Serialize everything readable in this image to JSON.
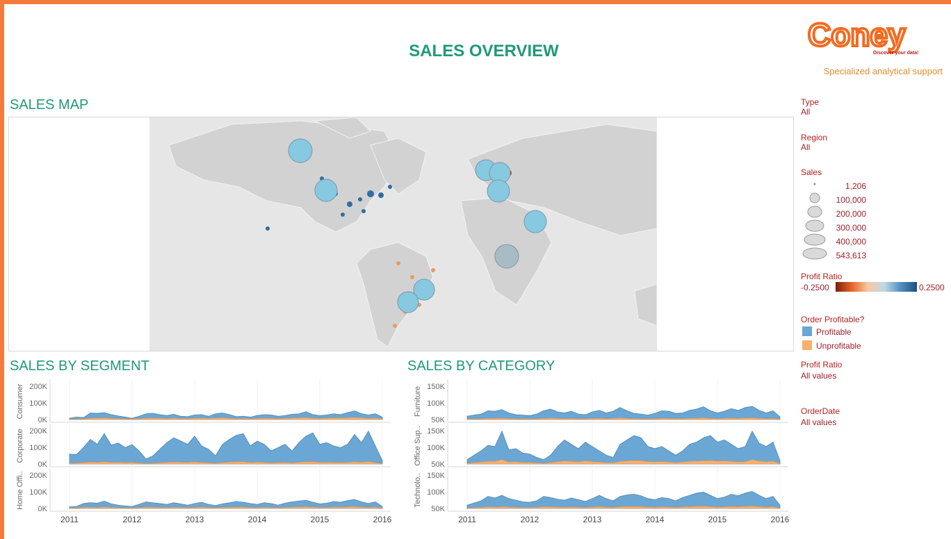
{
  "header": {
    "title": "SALES OVERVIEW",
    "logo_text": "Coney",
    "logo_tagline": "Discover your data!",
    "tagline": "Specialized analytical support"
  },
  "sections": {
    "map_title": "SALES MAP",
    "segment_title": "SALES BY SEGMENT",
    "category_title": "SALES BY CATEGORY"
  },
  "filters": {
    "type_label": "Type",
    "type_value": "All",
    "region_label": "Region",
    "region_value": "All",
    "sales_label": "Sales",
    "sales_sizes": [
      "1,206",
      "100,000",
      "200,000",
      "300,000",
      "400,000",
      "543,613"
    ],
    "profit_ratio_label": "Profit Ratio",
    "profit_ratio_min": "-0.2500",
    "profit_ratio_max": "0.2500",
    "order_profitable_label": "Order Profitable?",
    "profitable_label": "Profitable",
    "unprofitable_label": "Unprofitable",
    "profit_ratio_filter_label": "Profit Ratio",
    "profit_ratio_filter_value": "All values",
    "orderdate_label": "OrderDate",
    "orderdate_value": "All values"
  },
  "colors": {
    "profitable": "#6aa7d4",
    "unprofitable": "#f6b070",
    "accent": "#1f9a77",
    "legend_text": "#b22222"
  },
  "chart_data": [
    {
      "type": "area",
      "title": "SALES BY SEGMENT",
      "x_ticks": [
        "2011",
        "2012",
        "2013",
        "2014",
        "2015",
        "2016"
      ],
      "rows": [
        {
          "name": "Consumer",
          "y_ticks": [
            "200K",
            "100K",
            "0K"
          ],
          "ylim": [
            0,
            220000
          ],
          "profitable": [
            8000,
            15000,
            12000,
            40000,
            38000,
            42000,
            30000,
            22000,
            15000,
            8000,
            20000,
            35000,
            38000,
            30000,
            25000,
            32000,
            20000,
            18000,
            28000,
            30000,
            20000,
            35000,
            40000,
            30000,
            18000,
            20000,
            15000,
            25000,
            30000,
            28000,
            20000,
            24000,
            32000,
            35000,
            48000,
            30000,
            24000,
            28000,
            35000,
            30000,
            42000,
            52000,
            36000,
            28000,
            35000,
            15000
          ],
          "unprofitable": [
            2000,
            3000,
            4000,
            8000,
            9000,
            10000,
            7000,
            5000,
            4000,
            3000,
            5000,
            8000,
            9000,
            8000,
            6000,
            8000,
            5000,
            5000,
            8000,
            9000,
            6000,
            9000,
            11000,
            8000,
            5000,
            5000,
            4000,
            7000,
            8000,
            7000,
            5000,
            7000,
            9000,
            10000,
            12000,
            8000,
            6000,
            8000,
            10000,
            9000,
            11000,
            13000,
            10000,
            7000,
            9000,
            3000
          ]
        },
        {
          "name": "Corporate",
          "y_ticks": [
            "200K",
            "100K",
            "0K"
          ],
          "ylim": [
            0,
            220000
          ],
          "profitable": [
            60000,
            58000,
            100000,
            150000,
            120000,
            185000,
            115000,
            128000,
            100000,
            118000,
            80000,
            30000,
            50000,
            90000,
            130000,
            160000,
            140000,
            120000,
            170000,
            110000,
            90000,
            50000,
            120000,
            150000,
            175000,
            185000,
            110000,
            140000,
            120000,
            80000,
            100000,
            120000,
            80000,
            130000,
            170000,
            190000,
            120000,
            130000,
            110000,
            100000,
            120000,
            180000,
            130000,
            200000,
            110000,
            20000
          ],
          "unprofitable": [
            4000,
            5000,
            8000,
            12000,
            10000,
            14000,
            9000,
            10000,
            8000,
            9000,
            6000,
            3000,
            4000,
            7000,
            10000,
            12000,
            11000,
            9000,
            13000,
            9000,
            7000,
            4000,
            9000,
            12000,
            13000,
            14000,
            9000,
            11000,
            9000,
            6000,
            8000,
            9000,
            6000,
            10000,
            13000,
            14000,
            9000,
            10000,
            9000,
            8000,
            9000,
            13000,
            10000,
            15000,
            8000,
            2000
          ]
        },
        {
          "name": "Home Offi..",
          "y_ticks": [
            "200K",
            "100K",
            "0K"
          ],
          "ylim": [
            0,
            220000
          ],
          "profitable": [
            10000,
            12000,
            30000,
            35000,
            32000,
            45000,
            28000,
            20000,
            15000,
            12000,
            25000,
            40000,
            35000,
            30000,
            25000,
            35000,
            28000,
            20000,
            30000,
            38000,
            25000,
            18000,
            28000,
            35000,
            42000,
            38000,
            30000,
            25000,
            35000,
            30000,
            20000,
            32000,
            40000,
            45000,
            50000,
            38000,
            28000,
            32000,
            42000,
            38000,
            48000,
            55000,
            40000,
            30000,
            40000,
            12000
          ],
          "unprofitable": [
            3000,
            3000,
            6000,
            7000,
            6000,
            9000,
            6000,
            4000,
            3000,
            3000,
            5000,
            8000,
            7000,
            6000,
            5000,
            7000,
            6000,
            4000,
            6000,
            8000,
            5000,
            4000,
            6000,
            7000,
            8000,
            8000,
            6000,
            5000,
            7000,
            6000,
            4000,
            6000,
            8000,
            9000,
            10000,
            8000,
            6000,
            6000,
            8000,
            8000,
            10000,
            11000,
            8000,
            6000,
            8000,
            2000
          ]
        }
      ]
    },
    {
      "type": "area",
      "title": "SALES BY CATEGORY",
      "x_ticks": [
        "2011",
        "2012",
        "2013",
        "2014",
        "2015",
        "2016"
      ],
      "rows": [
        {
          "name": "Furniture",
          "y_ticks": [
            "150K",
            "100K",
            "50K"
          ],
          "ylim": [
            0,
            165000
          ],
          "profitable": [
            15000,
            20000,
            25000,
            40000,
            38000,
            45000,
            30000,
            22000,
            20000,
            18000,
            25000,
            40000,
            48000,
            35000,
            30000,
            38000,
            25000,
            22000,
            35000,
            42000,
            30000,
            38000,
            55000,
            40000,
            28000,
            25000,
            20000,
            28000,
            40000,
            38000,
            28000,
            30000,
            42000,
            48000,
            58000,
            40000,
            30000,
            38000,
            50000,
            42000,
            55000,
            60000,
            42000,
            30000,
            40000,
            12000
          ],
          "unprofitable": [
            2000,
            2500,
            3000,
            5000,
            5000,
            6000,
            4000,
            3000,
            2500,
            2500,
            3000,
            5000,
            6000,
            5000,
            4000,
            5000,
            3000,
            3000,
            5000,
            5500,
            4000,
            5000,
            7000,
            5000,
            3500,
            3000,
            2500,
            3500,
            5000,
            5000,
            3500,
            4000,
            5500,
            6000,
            7500,
            5000,
            4000,
            5000,
            6500,
            5500,
            7000,
            7500,
            5500,
            4000,
            5000,
            1500
          ]
        },
        {
          "name": "Office Sup..",
          "y_ticks": [
            "150K",
            "100K",
            "50K"
          ],
          "ylim": [
            0,
            165000
          ],
          "profitable": [
            20000,
            40000,
            60000,
            85000,
            80000,
            150000,
            65000,
            70000,
            50000,
            45000,
            30000,
            20000,
            40000,
            80000,
            110000,
            90000,
            70000,
            100000,
            80000,
            60000,
            40000,
            30000,
            90000,
            110000,
            130000,
            120000,
            80000,
            70000,
            80000,
            60000,
            40000,
            60000,
            90000,
            100000,
            120000,
            130000,
            100000,
            110000,
            90000,
            70000,
            80000,
            150000,
            95000,
            80000,
            100000,
            15000
          ],
          "unprofitable": [
            3000,
            6000,
            9000,
            12000,
            12000,
            20000,
            9000,
            10000,
            7000,
            7000,
            5000,
            3000,
            6000,
            11000,
            14000,
            12000,
            10000,
            14000,
            11000,
            9000,
            6000,
            5000,
            12000,
            14000,
            16000,
            15000,
            11000,
            10000,
            11000,
            9000,
            6000,
            9000,
            12000,
            13000,
            15000,
            16000,
            13000,
            14000,
            12000,
            10000,
            11000,
            20000,
            13000,
            11000,
            13000,
            2000
          ]
        },
        {
          "name": "Technolo..",
          "y_ticks": [
            "150K",
            "100K",
            "50K"
          ],
          "ylim": [
            0,
            165000
          ],
          "profitable": [
            15000,
            25000,
            35000,
            55000,
            48000,
            60000,
            45000,
            38000,
            30000,
            28000,
            35000,
            55000,
            50000,
            42000,
            38000,
            48000,
            40000,
            32000,
            45000,
            60000,
            45000,
            35000,
            55000,
            62000,
            65000,
            58000,
            45000,
            40000,
            50000,
            45000,
            35000,
            50000,
            60000,
            70000,
            75000,
            60000,
            45000,
            52000,
            65000,
            58000,
            70000,
            78000,
            60000,
            45000,
            55000,
            15000
          ],
          "unprofitable": [
            2000,
            3500,
            5000,
            7500,
            6500,
            8000,
            6000,
            5000,
            4000,
            4000,
            5000,
            7500,
            7000,
            6000,
            5000,
            6500,
            5500,
            4500,
            6000,
            8000,
            6000,
            5000,
            7500,
            8500,
            9000,
            8000,
            6000,
            5500,
            7000,
            6000,
            5000,
            7000,
            8000,
            9500,
            10000,
            8000,
            6000,
            7000,
            9000,
            8000,
            9500,
            10500,
            8000,
            6000,
            7500,
            2000
          ]
        }
      ]
    }
  ]
}
